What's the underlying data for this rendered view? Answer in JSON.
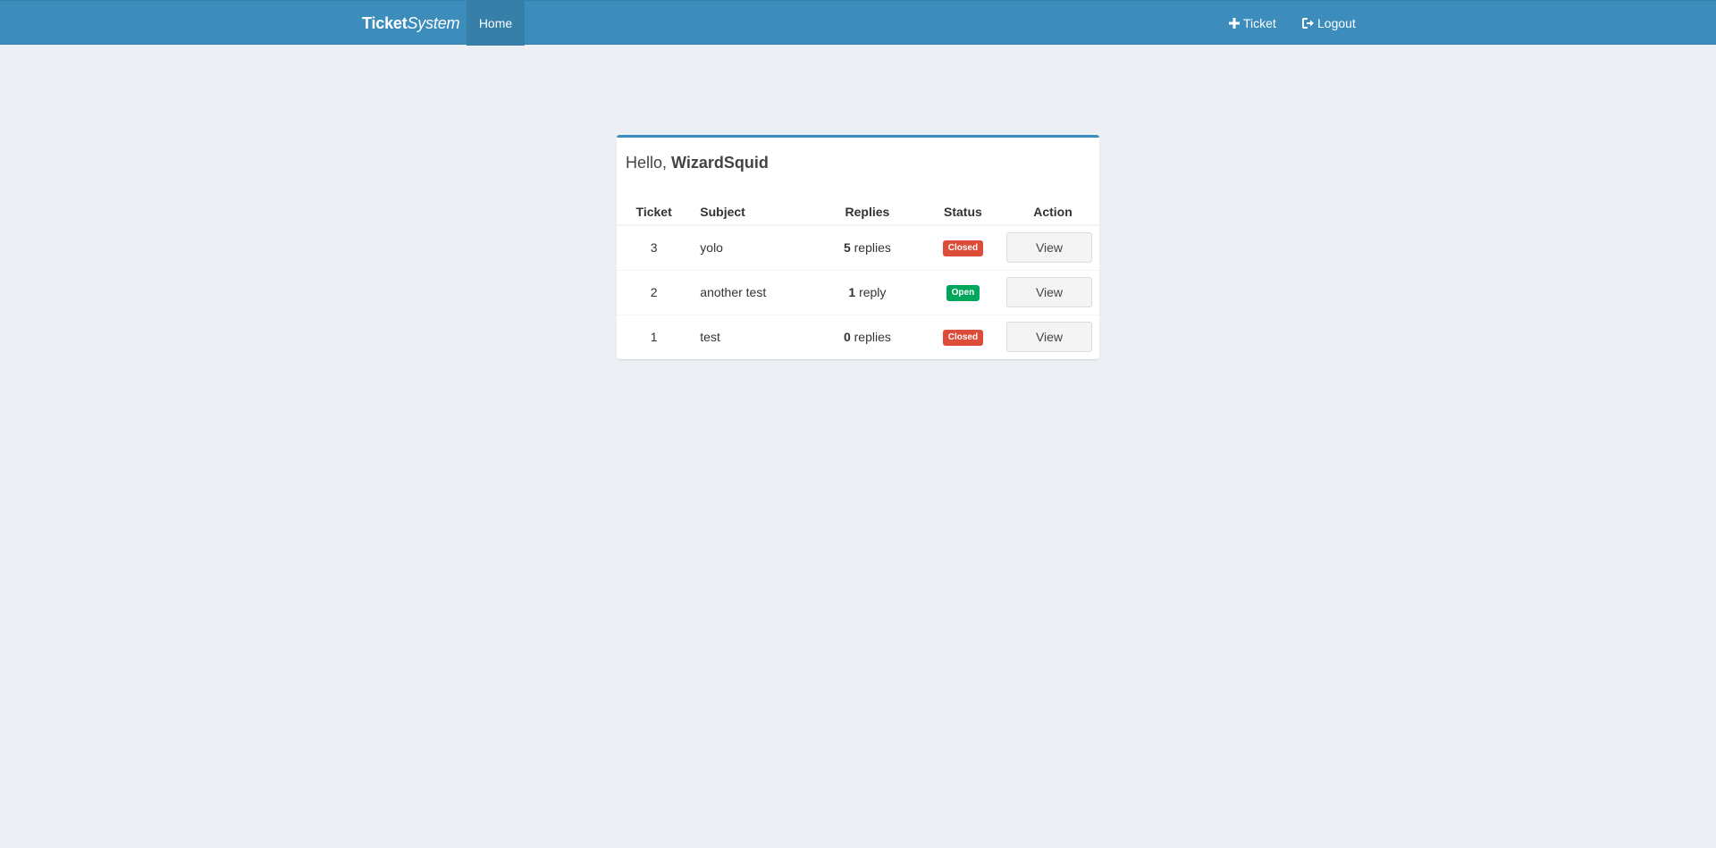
{
  "navbar": {
    "brand_bold": "Ticket",
    "brand_italic": "System",
    "home_label": "Home",
    "new_ticket_icon": "plus-icon",
    "new_ticket_label": "Ticket",
    "logout_icon": "sign-out-icon",
    "logout_label": "Logout",
    "bg_color": "#3c8dbc"
  },
  "greeting": {
    "prefix": "Hello,",
    "username": "WizardSquid"
  },
  "table": {
    "headers": [
      "Ticket",
      "Subject",
      "Replies",
      "Status",
      "Action"
    ],
    "rows": [
      {
        "id": "3",
        "subject": "yolo",
        "reply_count": "5",
        "reply_word": "replies",
        "status": "Closed",
        "action": "View"
      },
      {
        "id": "2",
        "subject": "another test",
        "reply_count": "1",
        "reply_word": "reply",
        "status": "Open",
        "action": "View"
      },
      {
        "id": "1",
        "subject": "test",
        "reply_count": "0",
        "reply_word": "replies",
        "status": "Closed",
        "action": "View"
      }
    ]
  },
  "colors": {
    "closed": "#dd4b39",
    "open": "#00a65a",
    "page_bg": "#ecf0f5"
  }
}
